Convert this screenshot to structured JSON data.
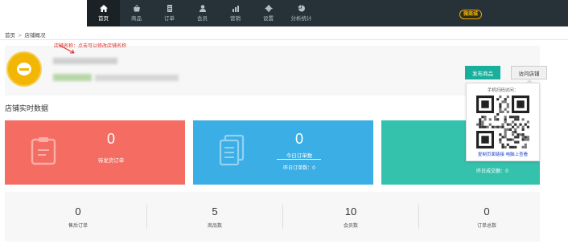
{
  "nav": {
    "items": [
      {
        "label": "首页",
        "icon": "home-icon"
      },
      {
        "label": "商品",
        "icon": "basket-icon"
      },
      {
        "label": "订单",
        "icon": "document-icon"
      },
      {
        "label": "会员",
        "icon": "user-icon"
      },
      {
        "label": "营销",
        "icon": "chart-icon"
      },
      {
        "label": "设置",
        "icon": "gear-icon"
      },
      {
        "label": "分析统计",
        "icon": "pie-icon"
      }
    ],
    "active_index": 0,
    "badge": "微商城"
  },
  "breadcrumb": {
    "home": "首页",
    "separator": ">",
    "current": "店铺概况"
  },
  "shop": {
    "hint": "店铺名称：点击可以修改店铺名称",
    "publish_button": "发布商品",
    "visit_button": "访问店铺"
  },
  "section_title": "店铺实时数据",
  "cards": {
    "red": {
      "value": "0",
      "label": "待发货订单"
    },
    "blue": {
      "value": "0",
      "label": "今日订单数",
      "sub": "昨日订单数：0"
    },
    "teal": {
      "sub": "昨日成交额：0"
    }
  },
  "qr": {
    "title": "手机扫码访问：",
    "copy_link": "复制页面链接",
    "open_link": "电脑上查看"
  },
  "bottom_stats": [
    {
      "value": "0",
      "label": "售后订单"
    },
    {
      "value": "5",
      "label": "商品数"
    },
    {
      "value": "10",
      "label": "会员数"
    },
    {
      "value": "0",
      "label": "订单总数"
    }
  ],
  "colors": {
    "nav_bg": "#263238",
    "red_card": "#f46c62",
    "blue_card": "#3baee6",
    "teal_card": "#34c2ad",
    "primary_button": "#1aaf9d",
    "hint_text": "#e0312b"
  }
}
